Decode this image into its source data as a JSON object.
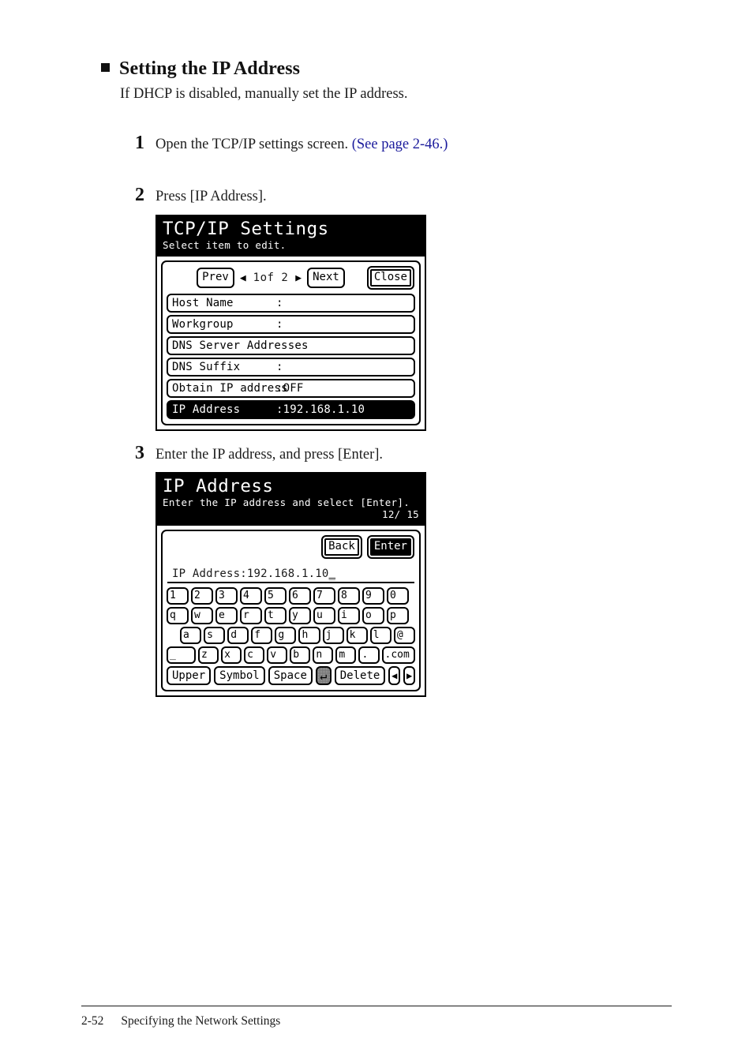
{
  "heading": {
    "bullet": "black-square-bullet",
    "title": "Setting the IP Address",
    "intro": "If DHCP is disabled, manually set the IP address."
  },
  "steps": [
    {
      "number": "1",
      "text": "Open the TCP/IP settings screen. ",
      "link": "(See page 2-46.)"
    },
    {
      "number": "2",
      "text": "Press [IP Address]."
    },
    {
      "number": "3",
      "text": "Enter the IP address, and press [Enter]."
    }
  ],
  "lcd_tcpip": {
    "title": "TCP/IP Settings",
    "subtitle": "Select item to edit.",
    "nav": {
      "prev_label": "Prev",
      "left_arrow": "◀",
      "page_label": "1of  2",
      "right_arrow": "▶",
      "next_label": "Next",
      "close_label": "Close"
    },
    "rows": [
      {
        "label": "Host Name",
        "value": ":",
        "selected": false
      },
      {
        "label": "Workgroup",
        "value": ":",
        "selected": false
      },
      {
        "label": "DNS Server Addresses",
        "value": "",
        "selected": false
      },
      {
        "label": "DNS Suffix",
        "value": ":",
        "selected": false
      },
      {
        "label": "Obtain IP address",
        "value": ":OFF",
        "selected": false
      },
      {
        "label": "IP Address",
        "value": ":192.168.1.10",
        "selected": true
      }
    ]
  },
  "lcd_ipaddr": {
    "title": "IP Address",
    "subtitle": "Enter the IP address and select [Enter].",
    "counter": "12/ 15",
    "buttons": {
      "back_label": "Back",
      "enter_label": "Enter"
    },
    "field": {
      "label": "IP Address:",
      "value": "192.168.1.10",
      "caret": "_"
    },
    "keyboard": {
      "row1": [
        "1",
        "2",
        "3",
        "4",
        "5",
        "6",
        "7",
        "8",
        "9",
        "0"
      ],
      "row2": [
        "q",
        "w",
        "e",
        "r",
        "t",
        "y",
        "u",
        "i",
        "o",
        "p"
      ],
      "row3": [
        "a",
        "s",
        "d",
        "f",
        "g",
        "h",
        "j",
        "k",
        "l",
        "@"
      ],
      "row4": [
        "_",
        "z",
        "x",
        "c",
        "v",
        "b",
        "n",
        "m",
        ".",
        ".com"
      ],
      "bottom": [
        {
          "label": "Upper",
          "kind": "fn"
        },
        {
          "label": "Symbol",
          "kind": "fn"
        },
        {
          "label": "Space",
          "kind": "fn"
        },
        {
          "label": "↵",
          "kind": "enter"
        },
        {
          "label": "Delete",
          "kind": "fn"
        },
        {
          "label": "◀",
          "kind": "arrow"
        },
        {
          "label": "▶",
          "kind": "arrow"
        }
      ]
    }
  },
  "footer": {
    "page_number": "2-52",
    "section": "Specifying the Network Settings"
  },
  "colors": {
    "link": "#1b1b9c",
    "text": "#1a1a1a",
    "lcd_bg": "#ffffff",
    "lcd_header_bg": "#000000"
  }
}
